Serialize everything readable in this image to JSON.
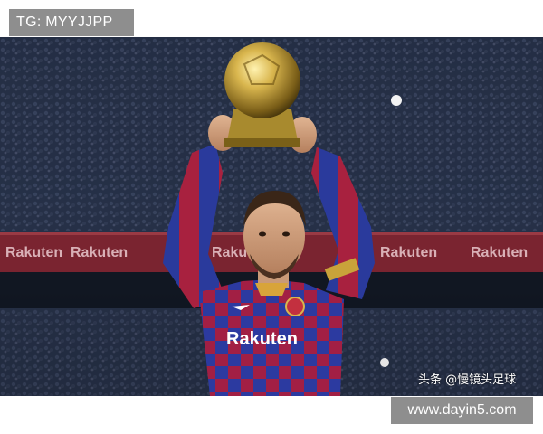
{
  "overlay": {
    "tg_label": "TG: MYYJJPP",
    "toutiao_watermark": "头条 @慢镜头足球",
    "site_watermark": "www.dayin5.com"
  },
  "photo": {
    "subject": "footballer-holding-golden-ball-trophy",
    "ad_boards": [
      "Rakuten",
      "Rakuten",
      "Rakuten",
      "Rakuten",
      "Rakuten"
    ],
    "shirt_sponsor": "Rakuten",
    "colors": {
      "stadium_dark": "#1b2436",
      "crowd": "#2a3348",
      "ad_board": "#7a2430",
      "shirt_blue": "#2a3a9c",
      "shirt_red": "#a8213f",
      "trophy_gold": "#c9a640"
    }
  }
}
